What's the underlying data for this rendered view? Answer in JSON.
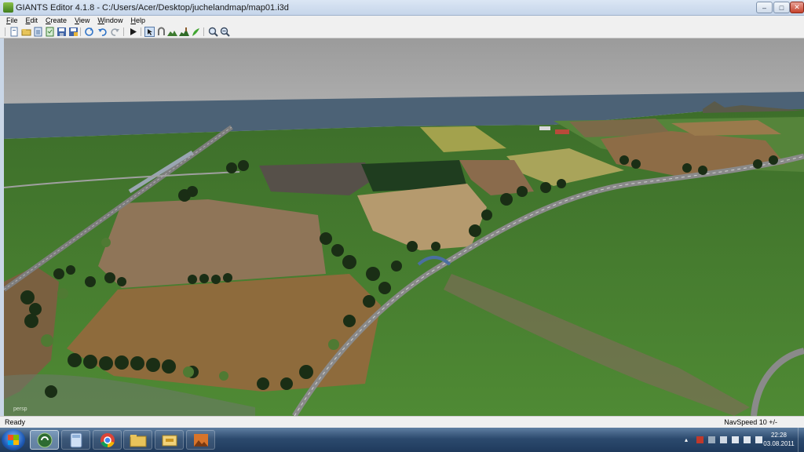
{
  "window": {
    "title": "GIANTS Editor 4.1.8 - C:/Users/Acer/Desktop/juchelandmap/map01.i3d",
    "minimize_label": "–",
    "maximize_label": "□",
    "close_label": "✕"
  },
  "menu": {
    "items": [
      "File",
      "Edit",
      "Create",
      "View",
      "Window",
      "Help"
    ]
  },
  "toolbar": {
    "icons": [
      "new-file-icon",
      "open-icon",
      "import-icon",
      "export-icon",
      "save-icon",
      "save-as-icon",
      "refresh-icon",
      "undo-icon",
      "redo-icon",
      "play-icon",
      "select-icon",
      "move-icon",
      "terrain-sculpt-icon",
      "terrain-paint-icon",
      "foliage-paint-icon",
      "zoom-in-icon",
      "zoom-out-icon"
    ]
  },
  "viewport": {
    "camera_label": "persp",
    "colors": {
      "sky": "#9c9c9c",
      "water": "#4f6578",
      "grass": "#3f7a2b",
      "field_brown": "#8a6a3f",
      "road": "#7a7a7a"
    }
  },
  "statusbar": {
    "left": "Ready",
    "right": "NavSpeed 10 +/-"
  },
  "taskbar": {
    "apps": [
      "start-button",
      "giants-editor-app",
      "calculator-app",
      "chrome-app",
      "explorer-app",
      "folder-app",
      "image-app"
    ],
    "clock_time": "22:28",
    "clock_date": "03.08.2011"
  }
}
